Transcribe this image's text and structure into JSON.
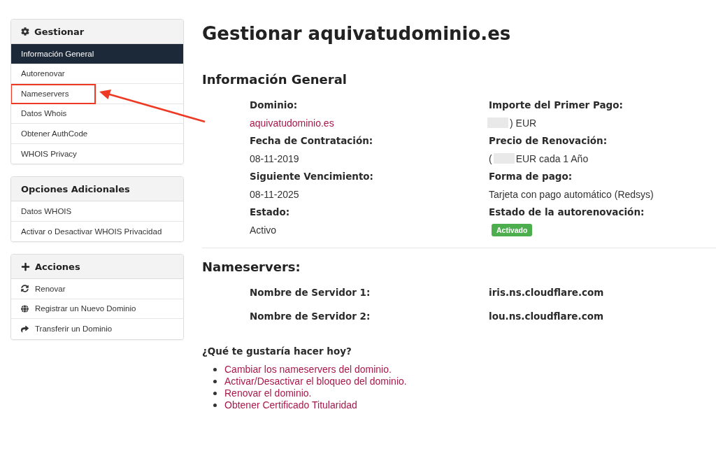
{
  "sidebar": {
    "panels": [
      {
        "title": "Gestionar",
        "items": [
          {
            "label": "Información General",
            "selected": true,
            "highlighted": false
          },
          {
            "label": "Autorenovar",
            "selected": false,
            "highlighted": false
          },
          {
            "label": "Nameservers",
            "selected": false,
            "highlighted": true
          },
          {
            "label": "Datos Whois",
            "selected": false,
            "highlighted": false
          },
          {
            "label": "Obtener AuthCode",
            "selected": false,
            "highlighted": false
          },
          {
            "label": "WHOIS Privacy",
            "selected": false,
            "highlighted": false
          }
        ]
      },
      {
        "title": "Opciones Adicionales",
        "items": [
          {
            "label": "Datos WHOIS",
            "selected": false,
            "highlighted": false
          },
          {
            "label": "Activar o Desactivar WHOIS Privacidad",
            "selected": false,
            "highlighted": false
          }
        ]
      },
      {
        "title": "Acciones",
        "items": [
          {
            "label": "Renovar",
            "selected": false,
            "highlighted": false
          },
          {
            "label": "Registrar un Nuevo Dominio",
            "selected": false,
            "highlighted": false
          },
          {
            "label": "Transferir un Dominio",
            "selected": false,
            "highlighted": false
          }
        ]
      }
    ]
  },
  "main": {
    "title": "Gestionar aquivatudominio.es",
    "general_info": {
      "heading": "Información General",
      "columns": [
        {
          "fields": [
            {
              "label": "Dominio:",
              "kind": "link",
              "value": "aquivatudominio.es"
            },
            {
              "label": "Fecha de Contratación:",
              "kind": "text",
              "value": "08-11-2019"
            },
            {
              "label": "Siguiente Vencimiento:",
              "kind": "text",
              "value": "08-11-2025"
            },
            {
              "label": "Estado:",
              "kind": "text",
              "value": "Activo"
            }
          ]
        },
        {
          "fields": [
            {
              "label": "Importe del Primer Pago:",
              "kind": "masked",
              "parts": [
                {
                  "kind": "redacted"
                },
                {
                  "kind": "text",
                  "text": ") EUR"
                }
              ]
            },
            {
              "label": "Precio de Renovación:",
              "kind": "masked",
              "parts": [
                {
                  "kind": "text",
                  "text": "("
                },
                {
                  "kind": "redacted"
                },
                {
                  "kind": "text",
                  "text": "EUR cada 1 Año"
                }
              ]
            },
            {
              "label": "Forma de pago:",
              "kind": "text",
              "value": "Tarjeta con pago automático (Redsys)"
            },
            {
              "label": "Estado de la autorenovación:",
              "kind": "badge",
              "value": "Activado"
            }
          ]
        }
      ]
    },
    "nameservers": {
      "heading": "Nameservers:",
      "rows": [
        {
          "label": "Nombre de Servidor 1:",
          "value": "iris.ns.cloudflare.com"
        },
        {
          "label": "Nombre de Servidor 2:",
          "value": "lou.ns.cloudflare.com"
        }
      ]
    },
    "actions": {
      "heading": "¿Qué te gustaría hacer hoy?",
      "links": [
        "Cambiar los nameservers del dominio.",
        "Activar/Desactivar el bloqueo del dominio.",
        "Renovar el dominio.",
        "Obtener Certificado Titularidad"
      ]
    }
  }
}
